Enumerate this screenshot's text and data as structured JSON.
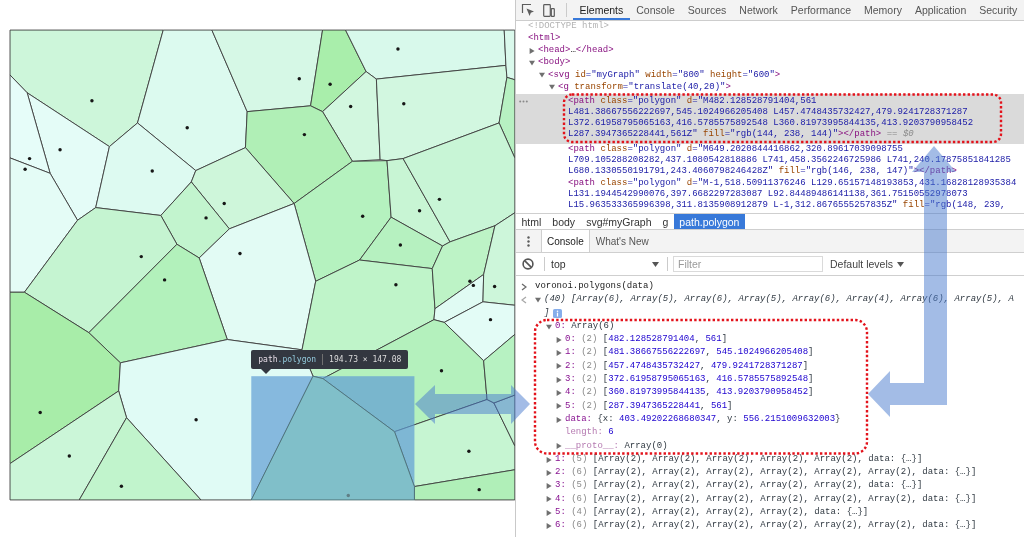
{
  "graph": {
    "cells": [
      {
        "color": "#cdf6da",
        "selected": false
      },
      {
        "color": "#dcfaef",
        "selected": false
      },
      {
        "color": "#d6f8e6",
        "selected": false
      },
      {
        "color": "#a9eeab",
        "selected": false
      },
      {
        "color": "#d8f9eb",
        "selected": false
      },
      {
        "color": "#d2f7df",
        "selected": false
      },
      {
        "color": "#d2f7e0",
        "selected": false
      },
      {
        "color": "#daf9ec",
        "selected": false
      },
      {
        "color": "#b7f1c2",
        "selected": false
      },
      {
        "color": "#e4fcf7",
        "selected": false
      },
      {
        "color": "#e6fdf9",
        "selected": false
      },
      {
        "color": "#e4fcf6",
        "selected": false
      },
      {
        "color": "#ddfaf1",
        "selected": false
      },
      {
        "color": "#b0efb6",
        "selected": false
      },
      {
        "color": "#cef6da",
        "selected": false
      },
      {
        "color": "#c2f4ce",
        "selected": false
      },
      {
        "color": "#b5f2bf",
        "selected": false
      },
      {
        "color": "#c8f5d4",
        "selected": false
      },
      {
        "color": "#c8f5d6",
        "selected": false
      },
      {
        "color": "#b6f1c0",
        "selected": false
      },
      {
        "color": "#e2fbf4",
        "selected": false
      },
      {
        "color": "#c5f4d1",
        "selected": false
      },
      {
        "color": "#b2f1bb",
        "selected": false
      },
      {
        "color": "#bff4c9",
        "selected": false
      },
      {
        "color": "#bdf3c6",
        "selected": false
      },
      {
        "color": "#e0fbf3",
        "selected": false
      },
      {
        "color": "#cdf6da",
        "selected": false
      },
      {
        "color": "#e3fcf6",
        "selected": false
      },
      {
        "color": "#b4f1bd",
        "selected": false
      },
      {
        "color": "#a8eda9",
        "selected": false
      },
      {
        "color": "#e0fbf5",
        "selected": false
      },
      {
        "color": "#cbf6d8",
        "selected": false
      },
      {
        "color": "#c1f4cc",
        "selected": false
      },
      {
        "color": "#80bfc9",
        "selected": true
      },
      {
        "color": "#c6f5d2",
        "selected": false
      },
      {
        "color": "#b0efb8",
        "selected": false
      },
      {
        "color": "#c7f5d4",
        "selected": false
      },
      {
        "color": "#b7f2c2",
        "selected": false
      }
    ],
    "tooltip": {
      "tag": "path",
      "class": ".polygon",
      "size": "194.73 × 147.08"
    }
  },
  "annotations": [
    {
      "kind": "outline"
    },
    {
      "kind": "outline"
    },
    {
      "kind": "double-arrow"
    },
    {
      "kind": "elbow-arrow"
    }
  ],
  "devtools": {
    "tabs": [
      {
        "label": "Elements",
        "selected": true
      },
      {
        "label": "Console",
        "selected": false
      },
      {
        "label": "Sources",
        "selected": false
      },
      {
        "label": "Network",
        "selected": false
      },
      {
        "label": "Performance",
        "selected": false
      },
      {
        "label": "Memory",
        "selected": false
      },
      {
        "label": "Application",
        "selected": false
      },
      {
        "label": "Security",
        "selected": false
      }
    ],
    "dom_tree": [
      {
        "selected": false,
        "lines": [
          [
            {
              "kind": "doctype",
              "text": "<!DOCTYPE html>"
            }
          ]
        ]
      },
      {
        "selected": false,
        "lines": [
          [
            {
              "kind": "tag",
              "text": "<html>"
            }
          ]
        ],
        "children": [
          {
            "selected": false,
            "expanded": false,
            "lines": [
              [
                {
                  "kind": "tag",
                  "text": "<head>"
                },
                {
                  "kind": "plain",
                  "text": "…"
                },
                {
                  "kind": "tag",
                  "text": "</head>"
                }
              ]
            ]
          },
          {
            "selected": false,
            "expanded": true,
            "lines": [
              [
                {
                  "kind": "tag",
                  "text": "<body>"
                }
              ]
            ],
            "children": [
              {
                "selected": false,
                "expanded": true,
                "lines": [
                  [
                    {
                      "kind": "tag",
                      "text": "<svg"
                    },
                    {
                      "kind": "attr",
                      "text": " id"
                    },
                    {
                      "kind": "value",
                      "text": "=\"myGraph\""
                    },
                    {
                      "kind": "attr",
                      "text": " width"
                    },
                    {
                      "kind": "value",
                      "text": "=\"800\""
                    },
                    {
                      "kind": "attr",
                      "text": " height"
                    },
                    {
                      "kind": "value",
                      "text": "=\"600\""
                    },
                    {
                      "kind": "tag",
                      "text": ">"
                    }
                  ]
                ],
                "children": [
                  {
                    "selected": false,
                    "expanded": true,
                    "lines": [
                      [
                        {
                          "kind": "tag",
                          "text": "<g"
                        },
                        {
                          "kind": "attr",
                          "text": " transform"
                        },
                        {
                          "kind": "value",
                          "text": "=\"translate(40,20)\""
                        },
                        {
                          "kind": "tag",
                          "text": ">"
                        }
                      ]
                    ],
                    "children": [
                      {
                        "selected": true,
                        "lines": [
                          [
                            {
                              "kind": "tag",
                              "text": "<path"
                            },
                            {
                              "kind": "attr",
                              "text": " class"
                            },
                            {
                              "kind": "value",
                              "text": "=\"polygon\""
                            },
                            {
                              "kind": "attr",
                              "text": " d"
                            },
                            {
                              "kind": "value",
                              "text": "=\"M482.128528791404,561"
                            }
                          ],
                          [
                            {
                              "kind": "value",
                              "text": "L481.38667556222697,545.1024966205408 L457.4748435732427,479.9241728371287"
                            }
                          ],
                          [
                            {
                              "kind": "value",
                              "text": "L372.61958795065163,416.5785575892548 L360.81973995844135,413.9203790958452"
                            }
                          ],
                          [
                            {
                              "kind": "value",
                              "text": "L287.3947365228441,561Z\""
                            },
                            {
                              "kind": "attr",
                              "text": " fill"
                            },
                            {
                              "kind": "value",
                              "text": "=\"rgb(144, 238, 144)\""
                            },
                            {
                              "kind": "tag",
                              "text": "></path>"
                            },
                            {
                              "kind": "hint",
                              "text": " == $0"
                            }
                          ]
                        ]
                      },
                      {
                        "selected": false,
                        "lines": [
                          [
                            {
                              "kind": "tag",
                              "text": "<path"
                            },
                            {
                              "kind": "attr",
                              "text": " class"
                            },
                            {
                              "kind": "value",
                              "text": "=\"polygon\""
                            },
                            {
                              "kind": "attr",
                              "text": " d"
                            },
                            {
                              "kind": "value",
                              "text": "=\"M649.2020844416862,320.89617039098755"
                            }
                          ],
                          [
                            {
                              "kind": "value",
                              "text": "L709.105288208282,437.1080542818886 L741,458.3562246725986 L741,240.17875851841285"
                            }
                          ],
                          [
                            {
                              "kind": "value",
                              "text": "L680.1330550191791,243.4060798246428Z\""
                            },
                            {
                              "kind": "attr",
                              "text": " fill"
                            },
                            {
                              "kind": "value",
                              "text": "=\"rgb(146, 238, 147)\""
                            },
                            {
                              "kind": "tag",
                              "text": "></path>"
                            }
                          ]
                        ]
                      },
                      {
                        "selected": false,
                        "lines": [
                          [
                            {
                              "kind": "tag",
                              "text": "<path"
                            },
                            {
                              "kind": "attr",
                              "text": " class"
                            },
                            {
                              "kind": "value",
                              "text": "=\"polygon\""
                            },
                            {
                              "kind": "attr",
                              "text": " d"
                            },
                            {
                              "kind": "value",
                              "text": "=\"M-1,518.50911376246 L129.65157148193853,431.16828128935384"
                            }
                          ],
                          [
                            {
                              "kind": "value",
                              "text": "L131.1944542990076,397.6682297283087 L92.84489486141138,361.75150552978073"
                            }
                          ],
                          [
                            {
                              "kind": "value",
                              "text": "L15.963533365996398,311.8135908912879 L-1,312.8676555257835Z\""
                            },
                            {
                              "kind": "attr",
                              "text": " fill"
                            },
                            {
                              "kind": "value",
                              "text": "=\"rgb(148, 239,"
                            }
                          ]
                        ]
                      }
                    ]
                  }
                ]
              }
            ]
          }
        ]
      }
    ],
    "breadcrumbs": [
      {
        "label": "html",
        "selected": false
      },
      {
        "label": "body",
        "selected": false
      },
      {
        "label": "svg#myGraph",
        "selected": false
      },
      {
        "label": "g",
        "selected": false
      },
      {
        "label": "path.polygon",
        "selected": true
      }
    ],
    "drawer_tabs": [
      {
        "label": "Console",
        "selected": true
      },
      {
        "label": "What's New",
        "selected": false
      }
    ],
    "console_toolbar": {
      "context": "top",
      "filter": {
        "placeholder": "Filter"
      },
      "levels": "Default levels"
    },
    "console": [
      {
        "kind": "input",
        "text": "voronoi.polygons(data)"
      },
      {
        "kind": "result",
        "expanded": true,
        "info": true,
        "lines": [
          "(40) [Array(6), Array(5), Array(6), Array(5), Array(6), Array(4), Array(6), Array(5), A",
          "]"
        ],
        "children": [
          {
            "expanded": true,
            "segments": [
              {
                "kind": "key",
                "text": "0:"
              },
              {
                "kind": "plain",
                "text": " Array(6)"
              }
            ],
            "children": [
              {
                "expanded": false,
                "segments": [
                  {
                    "kind": "key",
                    "text": "0:"
                  },
                  {
                    "kind": "count",
                    "text": " (2)"
                  },
                  {
                    "kind": "plain",
                    "text": " ["
                  },
                  {
                    "kind": "number",
                    "text": "482.128528791404"
                  },
                  {
                    "kind": "plain",
                    "text": ", "
                  },
                  {
                    "kind": "number",
                    "text": "561"
                  },
                  {
                    "kind": "plain",
                    "text": "]"
                  }
                ]
              },
              {
                "expanded": false,
                "segments": [
                  {
                    "kind": "key",
                    "text": "1:"
                  },
                  {
                    "kind": "count",
                    "text": " (2)"
                  },
                  {
                    "kind": "plain",
                    "text": " ["
                  },
                  {
                    "kind": "number",
                    "text": "481.38667556222697"
                  },
                  {
                    "kind": "plain",
                    "text": ", "
                  },
                  {
                    "kind": "number",
                    "text": "545.1024966205408"
                  },
                  {
                    "kind": "plain",
                    "text": "]"
                  }
                ]
              },
              {
                "expanded": false,
                "segments": [
                  {
                    "kind": "key",
                    "text": "2:"
                  },
                  {
                    "kind": "count",
                    "text": " (2)"
                  },
                  {
                    "kind": "plain",
                    "text": " ["
                  },
                  {
                    "kind": "number",
                    "text": "457.4748435732427"
                  },
                  {
                    "kind": "plain",
                    "text": ", "
                  },
                  {
                    "kind": "number",
                    "text": "479.9241728371287"
                  },
                  {
                    "kind": "plain",
                    "text": "]"
                  }
                ]
              },
              {
                "expanded": false,
                "segments": [
                  {
                    "kind": "key",
                    "text": "3:"
                  },
                  {
                    "kind": "count",
                    "text": " (2)"
                  },
                  {
                    "kind": "plain",
                    "text": " ["
                  },
                  {
                    "kind": "number",
                    "text": "372.61958795065163"
                  },
                  {
                    "kind": "plain",
                    "text": ", "
                  },
                  {
                    "kind": "number",
                    "text": "416.5785575892548"
                  },
                  {
                    "kind": "plain",
                    "text": "]"
                  }
                ]
              },
              {
                "expanded": false,
                "segments": [
                  {
                    "kind": "key",
                    "text": "4:"
                  },
                  {
                    "kind": "count",
                    "text": " (2)"
                  },
                  {
                    "kind": "plain",
                    "text": " ["
                  },
                  {
                    "kind": "number",
                    "text": "360.81973995844135"
                  },
                  {
                    "kind": "plain",
                    "text": ", "
                  },
                  {
                    "kind": "number",
                    "text": "413.9203790958452"
                  },
                  {
                    "kind": "plain",
                    "text": "]"
                  }
                ]
              },
              {
                "expanded": false,
                "segments": [
                  {
                    "kind": "key",
                    "text": "5:"
                  },
                  {
                    "kind": "count",
                    "text": " (2)"
                  },
                  {
                    "kind": "plain",
                    "text": " ["
                  },
                  {
                    "kind": "number",
                    "text": "287.3947365228441"
                  },
                  {
                    "kind": "plain",
                    "text": ", "
                  },
                  {
                    "kind": "number",
                    "text": "561"
                  },
                  {
                    "kind": "plain",
                    "text": "]"
                  }
                ]
              },
              {
                "expanded": false,
                "segments": [
                  {
                    "kind": "key",
                    "text": "data:"
                  },
                  {
                    "kind": "plain",
                    "text": " {x: "
                  },
                  {
                    "kind": "number",
                    "text": "403.49202268680347"
                  },
                  {
                    "kind": "plain",
                    "text": ", y: "
                  },
                  {
                    "kind": "number",
                    "text": "556.2151009632003"
                  },
                  {
                    "kind": "plain",
                    "text": "}"
                  }
                ]
              },
              {
                "segments": [
                  {
                    "kind": "meta",
                    "text": "length:"
                  },
                  {
                    "kind": "number",
                    "text": " 6"
                  }
                ]
              },
              {
                "expanded": false,
                "segments": [
                  {
                    "kind": "meta",
                    "text": "__proto__:"
                  },
                  {
                    "kind": "plain",
                    "text": " Array(0)"
                  }
                ]
              }
            ]
          },
          {
            "expanded": false,
            "segments": [
              {
                "kind": "key",
                "text": "1:"
              },
              {
                "kind": "count",
                "text": " (5)"
              },
              {
                "kind": "plain",
                "text": " [Array(2), Array(2), Array(2), Array(2), Array(2), data: {…}]"
              }
            ]
          },
          {
            "expanded": false,
            "segments": [
              {
                "kind": "key",
                "text": "2:"
              },
              {
                "kind": "count",
                "text": " (6)"
              },
              {
                "kind": "plain",
                "text": " [Array(2), Array(2), Array(2), Array(2), Array(2), Array(2), data: {…}]"
              }
            ]
          },
          {
            "expanded": false,
            "segments": [
              {
                "kind": "key",
                "text": "3:"
              },
              {
                "kind": "count",
                "text": " (5)"
              },
              {
                "kind": "plain",
                "text": " [Array(2), Array(2), Array(2), Array(2), Array(2), data: {…}]"
              }
            ]
          },
          {
            "expanded": false,
            "segments": [
              {
                "kind": "key",
                "text": "4:"
              },
              {
                "kind": "count",
                "text": " (6)"
              },
              {
                "kind": "plain",
                "text": " [Array(2), Array(2), Array(2), Array(2), Array(2), Array(2), data: {…}]"
              }
            ]
          },
          {
            "expanded": false,
            "segments": [
              {
                "kind": "key",
                "text": "5:"
              },
              {
                "kind": "count",
                "text": " (4)"
              },
              {
                "kind": "plain",
                "text": " [Array(2), Array(2), Array(2), Array(2), data: {…}]"
              }
            ]
          },
          {
            "expanded": false,
            "segments": [
              {
                "kind": "key",
                "text": "6:"
              },
              {
                "kind": "count",
                "text": " (6)"
              },
              {
                "kind": "plain",
                "text": " [Array(2), Array(2), Array(2), Array(2), Array(2), Array(2), data: {…}]"
              }
            ]
          }
        ]
      }
    ]
  }
}
